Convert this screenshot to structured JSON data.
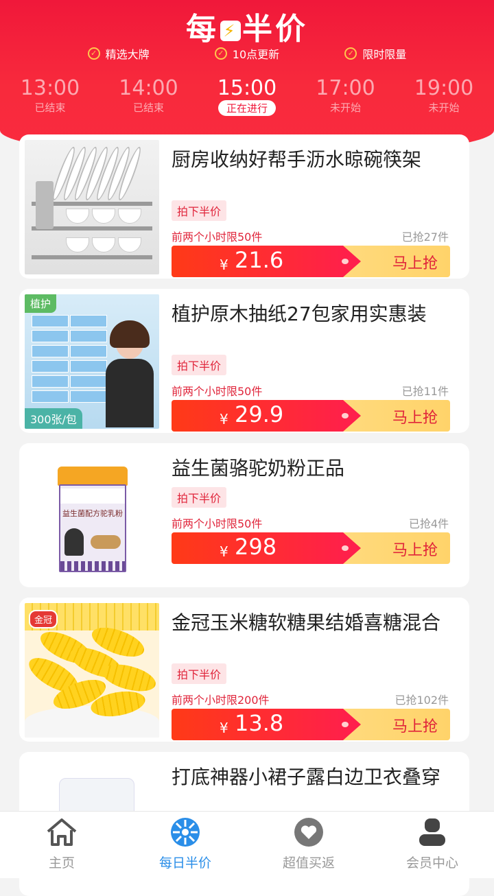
{
  "header": {
    "title_left": "每",
    "title_right": "半价",
    "features": [
      "精选大牌",
      "10点更新",
      "限时限量"
    ]
  },
  "time_slots": [
    {
      "time": "13:00",
      "status": "已结束",
      "active": false
    },
    {
      "time": "14:00",
      "status": "已结束",
      "active": false
    },
    {
      "time": "15:00",
      "status": "正在进行",
      "active": true
    },
    {
      "time": "17:00",
      "status": "未开始",
      "active": false
    },
    {
      "time": "19:00",
      "status": "未开始",
      "active": false
    }
  ],
  "products": [
    {
      "name": "厨房收纳好帮手沥水晾碗筷架",
      "tag": "拍下半价",
      "limit": "前两个小时限50件",
      "sold": "已抢27件",
      "currency": "¥",
      "price": "21.6",
      "button": "马上抢"
    },
    {
      "name": "植护原木抽纸27包家用实惠装",
      "tag": "拍下半价",
      "limit": "前两个小时限50件",
      "sold": "已抢11件",
      "currency": "¥",
      "price": "29.9",
      "button": "马上抢",
      "badge_brand": "植护",
      "badge_count": "300张/包"
    },
    {
      "name": "益生菌骆驼奶粉正品",
      "tag": "拍下半价",
      "limit": "前两个小时限50件",
      "sold": "已抢4件",
      "currency": "¥",
      "price": "298",
      "button": "马上抢",
      "can_label": "益生菌配方驼乳粉"
    },
    {
      "name": "金冠玉米糖软糖果结婚喜糖混合",
      "tag": "拍下半价",
      "limit": "前两个小时限200件",
      "sold": "已抢102件",
      "currency": "¥",
      "price": "13.8",
      "button": "马上抢",
      "badge_brand": "金冠"
    },
    {
      "name": "打底神器小裙子露白边卫衣叠穿"
    }
  ],
  "bottom_nav": [
    {
      "label": "主页",
      "icon": "home-icon",
      "active": false
    },
    {
      "label": "每日半价",
      "icon": "half-price-icon",
      "active": true
    },
    {
      "label": "超值买返",
      "icon": "heart-icon",
      "active": false
    },
    {
      "label": "会员中心",
      "icon": "member-icon",
      "active": false
    }
  ],
  "colors": {
    "brand_red": "#f0183a",
    "active_blue": "#2a8ee8",
    "button_gold": "#ffd36a"
  }
}
